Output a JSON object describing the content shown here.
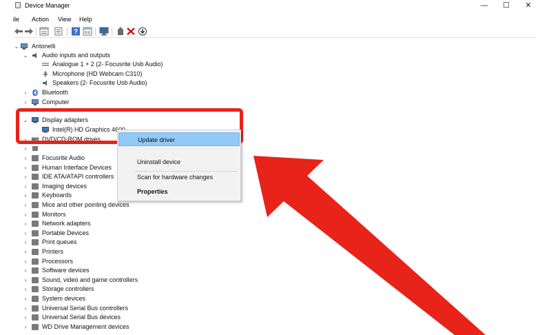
{
  "window": {
    "title": "Device Manager",
    "controls": {
      "minimize": "—",
      "maximize": "☐",
      "close": "✕"
    }
  },
  "menu": [
    "ile",
    "Action",
    "View",
    "Help"
  ],
  "toolbar": {
    "icons": [
      "back-arrow-icon",
      "forward-arrow-icon",
      "properties-icon",
      "device-list-icon",
      "help-icon",
      "details-icon",
      "monitor-icon",
      "add-driver-icon",
      "uninstall-x-icon",
      "download-icon"
    ]
  },
  "tree": {
    "root": "Antonelli",
    "audio": {
      "label": "Audio inputs and outputs",
      "children": [
        "Analogue 1 + 2 (2- Focusrite Usb Audio)",
        "Microphone (HD Webcam C310)",
        "Speakers (2- Focusrite Usb Audio)"
      ]
    },
    "bluetooth": "Bluetooth",
    "computer": "Computer",
    "display": {
      "label": "Display adapters",
      "children": [
        "Intel(R) HD Graphics 4600"
      ]
    },
    "dvd": "DVD/CD-ROM drives",
    "categories": [
      "Focusrite Audio",
      "Human Interface Devices",
      "IDE ATA/ATAPI controllers",
      "Imaging devices",
      "Keyboards",
      "Mice and other pointing devices",
      "Monitors",
      "Network adapters",
      "Portable Devices",
      "Print queues",
      "Printers",
      "Processors",
      "Software devices",
      "Sound, video and game controllers",
      "Storage controllers",
      "System devices",
      "Universal Serial Bus controllers",
      "Universal Serial Bus devices",
      "WD Drive Management devices"
    ]
  },
  "context_menu": {
    "update": "Update driver",
    "uninstall": "Uninstall device",
    "scan": "Scan for hardware changes",
    "properties": "Properties"
  },
  "colors": {
    "highlight": "#e8231a",
    "menu_selected": "#91c9f7"
  }
}
